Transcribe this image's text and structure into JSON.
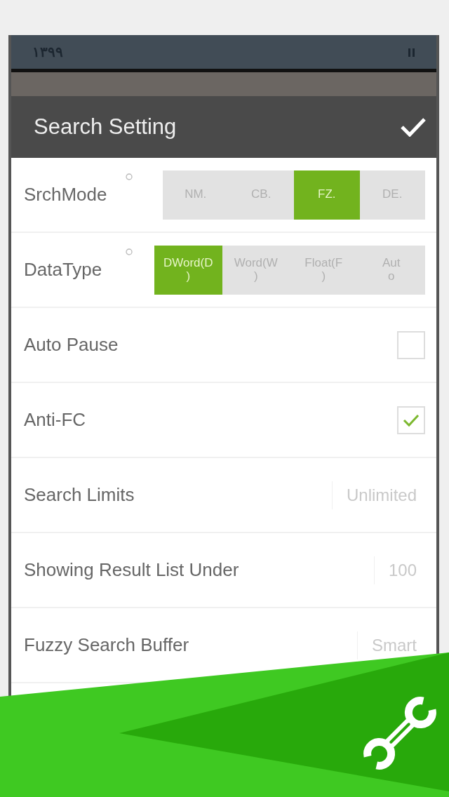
{
  "status_bar": {
    "time": "١٣٩٩"
  },
  "header": {
    "title": "Search Setting"
  },
  "settings": [
    {
      "kind": "segmented",
      "label": "SrchMode",
      "options": [
        {
          "label": "NM.",
          "selected": false
        },
        {
          "label": "CB.",
          "selected": false
        },
        {
          "label": "FZ.",
          "selected": true
        },
        {
          "label": "DE.",
          "selected": false
        }
      ]
    },
    {
      "kind": "segmented",
      "label": "DataType",
      "options": [
        {
          "label": "DWord(D\n)",
          "selected": true
        },
        {
          "label": "Word(W\n)",
          "selected": false
        },
        {
          "label": "Float(F\n)",
          "selected": false
        },
        {
          "label": "Aut\no",
          "selected": false
        }
      ]
    },
    {
      "kind": "checkbox",
      "label": "Auto Pause",
      "checked": false
    },
    {
      "kind": "checkbox",
      "label": "Anti-FC",
      "checked": true
    },
    {
      "kind": "value",
      "label": "Search Limits",
      "value": "Unlimited"
    },
    {
      "kind": "value",
      "label": "Showing Result List Under",
      "value": "100"
    },
    {
      "kind": "value",
      "label": "Fuzzy Search Buffer",
      "value": "Smart"
    }
  ]
}
